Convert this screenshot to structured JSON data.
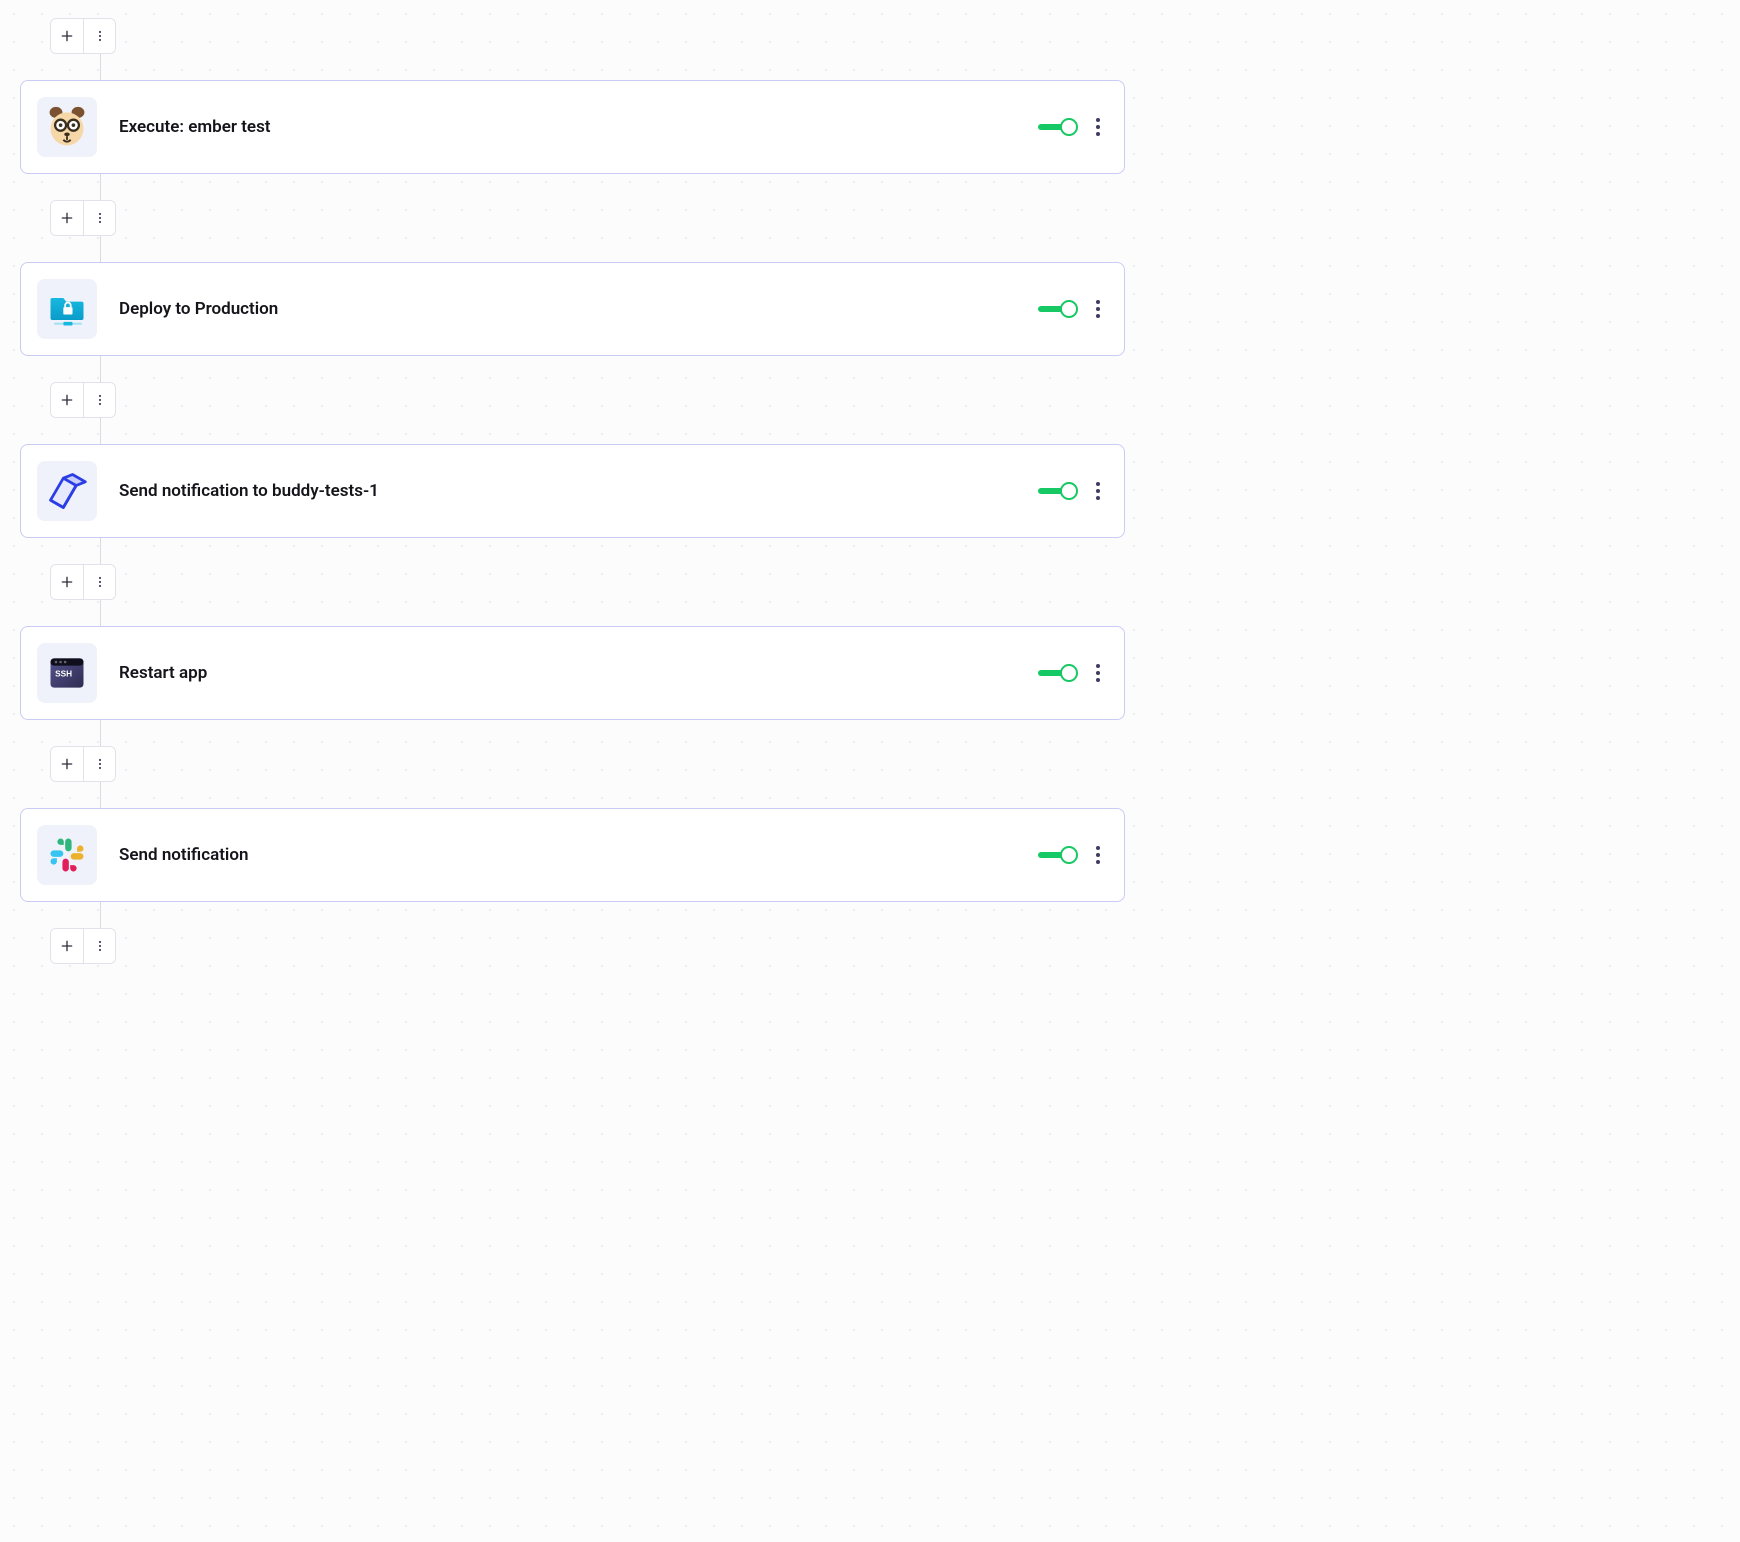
{
  "colors": {
    "card_border": "#c9ccf5",
    "toggle_on": "#17c964",
    "icon_bg": "#f0f2fb"
  },
  "steps": [
    {
      "id": "ember-test",
      "title": "Execute: ember test",
      "icon": "ember",
      "enabled": true
    },
    {
      "id": "deploy-prod",
      "title": "Deploy to Production",
      "icon": "sftp",
      "enabled": true
    },
    {
      "id": "notify-channel",
      "title": "Send notification to buddy-tests-1",
      "icon": "prism",
      "enabled": true
    },
    {
      "id": "restart-app",
      "title": "Restart app",
      "icon": "ssh",
      "enabled": true
    },
    {
      "id": "slack-notify",
      "title": "Send notification",
      "icon": "slack",
      "enabled": true
    }
  ]
}
